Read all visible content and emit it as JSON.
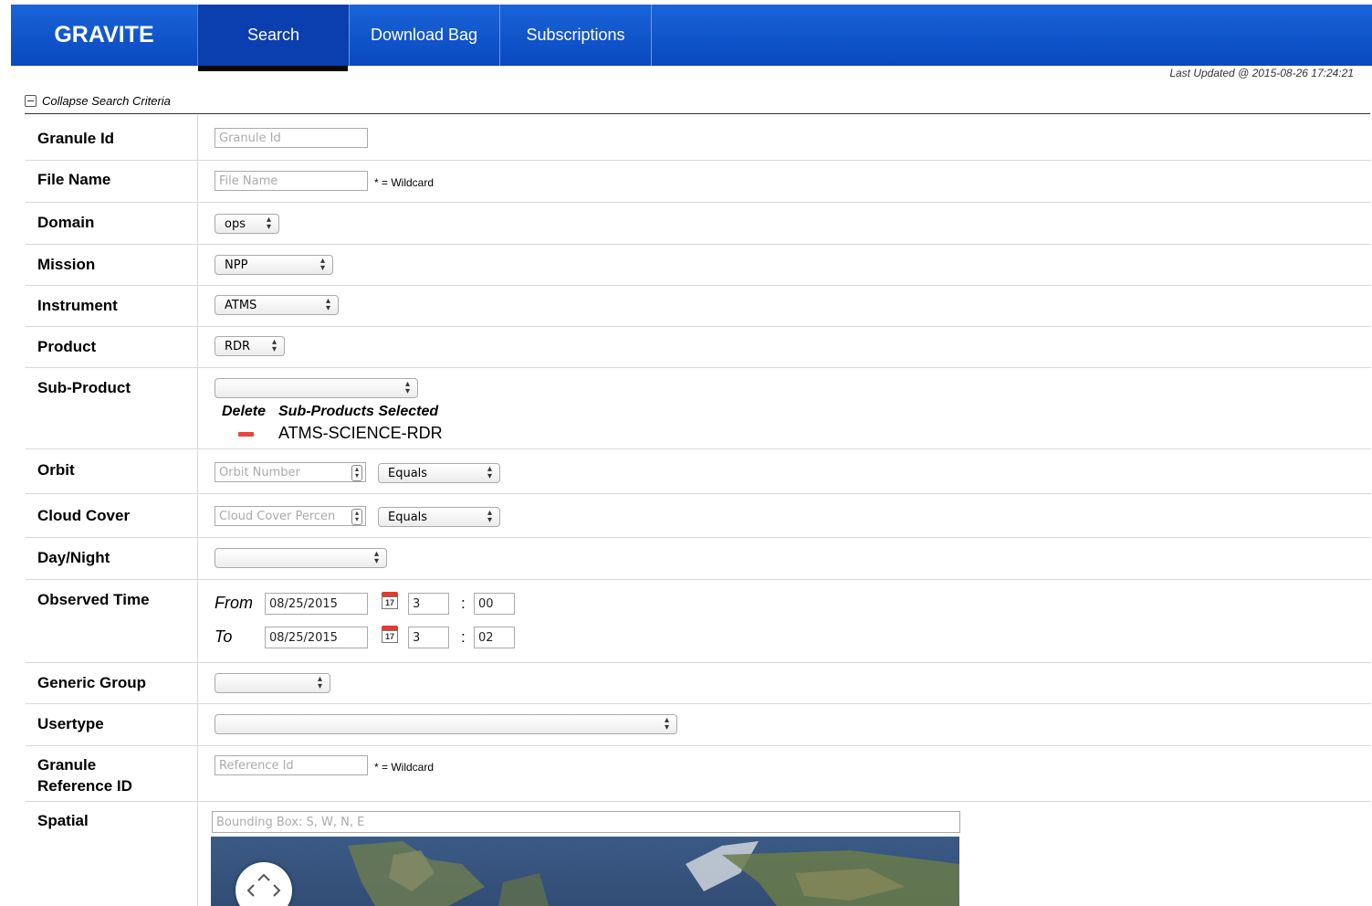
{
  "brand": "GRAVITE",
  "tabs": [
    {
      "label": "Search",
      "active": true
    },
    {
      "label": "Download Bag",
      "active": false
    },
    {
      "label": "Subscriptions",
      "active": false
    }
  ],
  "last_updated": "Last Updated @ 2015-08-26 17:24:21",
  "collapse_label": "Collapse Search Criteria",
  "wildcard_note": "* = Wildcard",
  "fields": {
    "granule_id": {
      "label": "Granule Id",
      "placeholder": "Granule Id",
      "value": ""
    },
    "file_name": {
      "label": "File Name",
      "placeholder": "File Name",
      "value": ""
    },
    "domain": {
      "label": "Domain",
      "value": "ops"
    },
    "mission": {
      "label": "Mission",
      "value": "NPP"
    },
    "instrument": {
      "label": "Instrument",
      "value": "ATMS"
    },
    "product": {
      "label": "Product",
      "value": "RDR"
    },
    "sub_product": {
      "label": "Sub-Product",
      "value": "",
      "delete_header": "Delete",
      "selected_header": "Sub-Products Selected",
      "selected": [
        "ATMS-SCIENCE-RDR"
      ]
    },
    "orbit": {
      "label": "Orbit",
      "placeholder": "Orbit Number",
      "operator": "Equals"
    },
    "cloud_cover": {
      "label": "Cloud Cover",
      "placeholder": "Cloud Cover Percen",
      "operator": "Equals"
    },
    "day_night": {
      "label": "Day/Night",
      "value": ""
    },
    "observed_time": {
      "label": "Observed Time",
      "from_label": "From",
      "to_label": "To",
      "from_date": "08/25/2015",
      "from_hour": "3",
      "from_minute": "00",
      "to_date": "08/25/2015",
      "to_hour": "3",
      "to_minute": "02",
      "calendar_day": "17",
      "colon": ":"
    },
    "generic_group": {
      "label": "Generic Group",
      "value": ""
    },
    "usertype": {
      "label": "Usertype",
      "value": ""
    },
    "granule_reference_id": {
      "label_line1": "Granule",
      "label_line2": "Reference ID",
      "placeholder": "Reference Id"
    },
    "spatial": {
      "label": "Spatial",
      "placeholder": "Bounding Box: S, W, N, E"
    }
  },
  "icons": {
    "collapse": "minus-box-icon",
    "calendar": "calendar-icon",
    "delete": "remove-icon",
    "map_nav": "pan-control-icon"
  },
  "colors": {
    "topbar": "#0a48c0",
    "active_tab": "#0b3fb0",
    "delete_red": "#e8453c"
  }
}
